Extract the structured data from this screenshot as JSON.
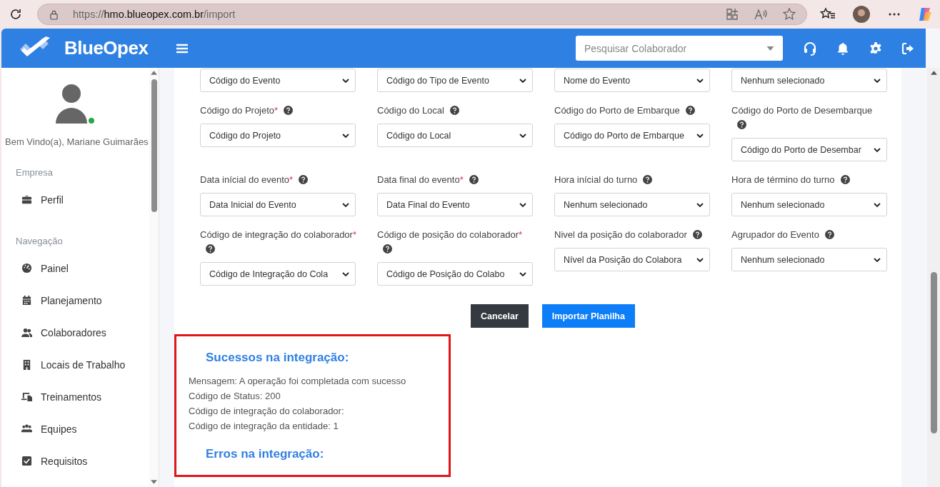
{
  "browser": {
    "url_parts": [
      "https://",
      "hmo.blueopex.com.br",
      "/import"
    ]
  },
  "header": {
    "brand": "BlueOpex",
    "search": {
      "placeholder": "Pesquisar Colaborador"
    }
  },
  "sidebar": {
    "welcome": "Bem Vindo(a), Mariane Guimarães",
    "online": true,
    "sections": [
      {
        "title": "Empresa",
        "items": [
          {
            "label": "Perfil",
            "kind": "briefcase"
          }
        ]
      },
      {
        "title": "Navegação",
        "items": [
          {
            "label": "Painel",
            "kind": "gauge"
          },
          {
            "label": "Planejamento",
            "kind": "calendar"
          },
          {
            "label": "Colaboradores",
            "kind": "users"
          },
          {
            "label": "Locais de Trabalho",
            "kind": "building"
          },
          {
            "label": "Treinamentos",
            "kind": "devices"
          },
          {
            "label": "Equipes",
            "kind": "group"
          },
          {
            "label": "Requisitos",
            "kind": "checkbox"
          }
        ]
      }
    ]
  },
  "form": {
    "rows": [
      [
        {
          "value": "Código do Evento"
        },
        {
          "value": "Código do Tipo de Evento"
        },
        {
          "value": "Nome do Evento"
        },
        {
          "value": "Nenhum selecionado"
        }
      ],
      [
        {
          "label": "Código do Projeto",
          "required_mark": "*",
          "help": true,
          "value": "Código do Projeto"
        },
        {
          "label": "Código do Local",
          "help": true,
          "value": "Código do Local"
        },
        {
          "label": "Código do Porto de Embarque",
          "help": true,
          "value": "Código do Porto de Embarque"
        },
        {
          "label": "Código do Porto de Desembarque",
          "help": true,
          "value": "Código do Porto de Desembar"
        }
      ],
      [
        {
          "label": "Data inícial do evento",
          "required_mark": "*",
          "help": true,
          "value": "Data Inicial do Evento"
        },
        {
          "label": "Data final do evento",
          "required_mark": "*",
          "help": true,
          "value": "Data Final do Evento"
        },
        {
          "label": "Hora inícial do turno",
          "help": true,
          "value": "Nenhum selecionado"
        },
        {
          "label": "Hora de término do turno",
          "help": true,
          "value": "Nenhum selecionado"
        }
      ],
      [
        {
          "label": "Código de integração do colaborador",
          "required_mark": "*",
          "help": true,
          "value": "Código de Integração do Cola"
        },
        {
          "label": "Código de posição do colaborador",
          "required_mark": "*",
          "help": true,
          "value": "Código de Posição do Colabo"
        },
        {
          "label": "Nivel da posição do colaborador",
          "help": true,
          "value": "Nível da Posição do Colabora"
        },
        {
          "label": "Agrupador do Evento",
          "help": true,
          "value": "Nenhum selecionado"
        }
      ]
    ]
  },
  "buttons": [
    {
      "label": "Cancelar",
      "kind": "secondary"
    },
    {
      "label": "Importar Planilha",
      "kind": "primary"
    }
  ],
  "results": {
    "success_title": "Sucessos na integração:",
    "lines": [
      "Mensagem: A operação foi completada com sucesso",
      "Código de Status: 200",
      "Código de integração do colaborador:",
      "Código de integração da entidade: 1"
    ],
    "errors_title": "Erros na integração:"
  }
}
